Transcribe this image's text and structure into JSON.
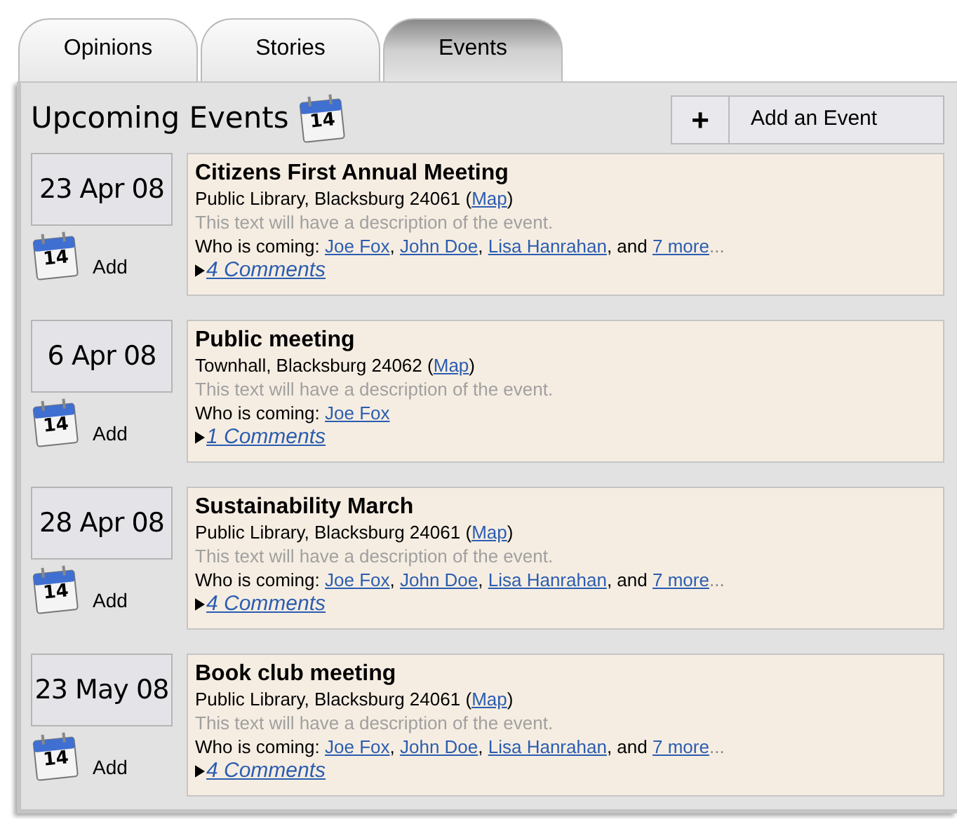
{
  "tabs": [
    {
      "label": "Opinions",
      "selected": false
    },
    {
      "label": "Stories",
      "selected": false
    },
    {
      "label": "Events",
      "selected": true
    }
  ],
  "header": {
    "title": "Upcoming Events",
    "icon_day": "14",
    "add_button": {
      "icon": "+",
      "label": "Add an Event"
    }
  },
  "events": [
    {
      "date": "23 Apr 08",
      "icon_day": "14",
      "add": "Add",
      "title": "Citizens First Annual Meeting",
      "location": "Public Library, Blacksburg 24061",
      "map_open": "(",
      "map": "Map",
      "map_close": ")",
      "description": "This text will have a description of the event.",
      "coming_label": "Who is coming:",
      "attendees": [
        "Joe Fox",
        "John Doe",
        "Lisa Hanrahan"
      ],
      "separator": ",",
      "conjunction": "and",
      "more": "7 more",
      "ellipsis": "...",
      "comments": "4 Comments",
      "expanded": false
    },
    {
      "date": "6 Apr 08",
      "icon_day": "14",
      "add": "Add",
      "title": "Public meeting",
      "location": "Townhall, Blacksburg 24062",
      "map_open": "(",
      "map": "Map",
      "map_close": ")",
      "description": "This text will have a description of the event.",
      "coming_label": "Who is coming:",
      "attendees": [
        "Joe Fox"
      ],
      "comments": "1 Comments",
      "expanded": false
    },
    {
      "date": "28 Apr 08",
      "icon_day": "14",
      "add": "Add",
      "title": "Sustainability March",
      "location": "Public Library, Blacksburg 24061",
      "map_open": "(",
      "map": "Map",
      "map_close": ")",
      "description": "This text will have a description of the event.",
      "coming_label": "Who is coming:",
      "attendees": [
        "Joe Fox",
        "John Doe",
        "Lisa Hanrahan"
      ],
      "separator": ",",
      "conjunction": "and",
      "more": "7 more",
      "ellipsis": "...",
      "comments": "4 Comments",
      "expanded": false
    },
    {
      "date": "23 May 08",
      "icon_day": "14",
      "add": "Add",
      "title": "Book club meeting",
      "location": "Public Library, Blacksburg 24061",
      "map_open": "(",
      "map": "Map",
      "map_close": ")",
      "description": "This text will have a description of the event.",
      "coming_label": "Who is coming:",
      "attendees": [
        "Joe Fox",
        "John Doe",
        "Lisa Hanrahan"
      ],
      "separator": ",",
      "conjunction": "and",
      "more": "7 more",
      "ellipsis": "...",
      "comments": "4 Comments",
      "expanded": false
    }
  ]
}
